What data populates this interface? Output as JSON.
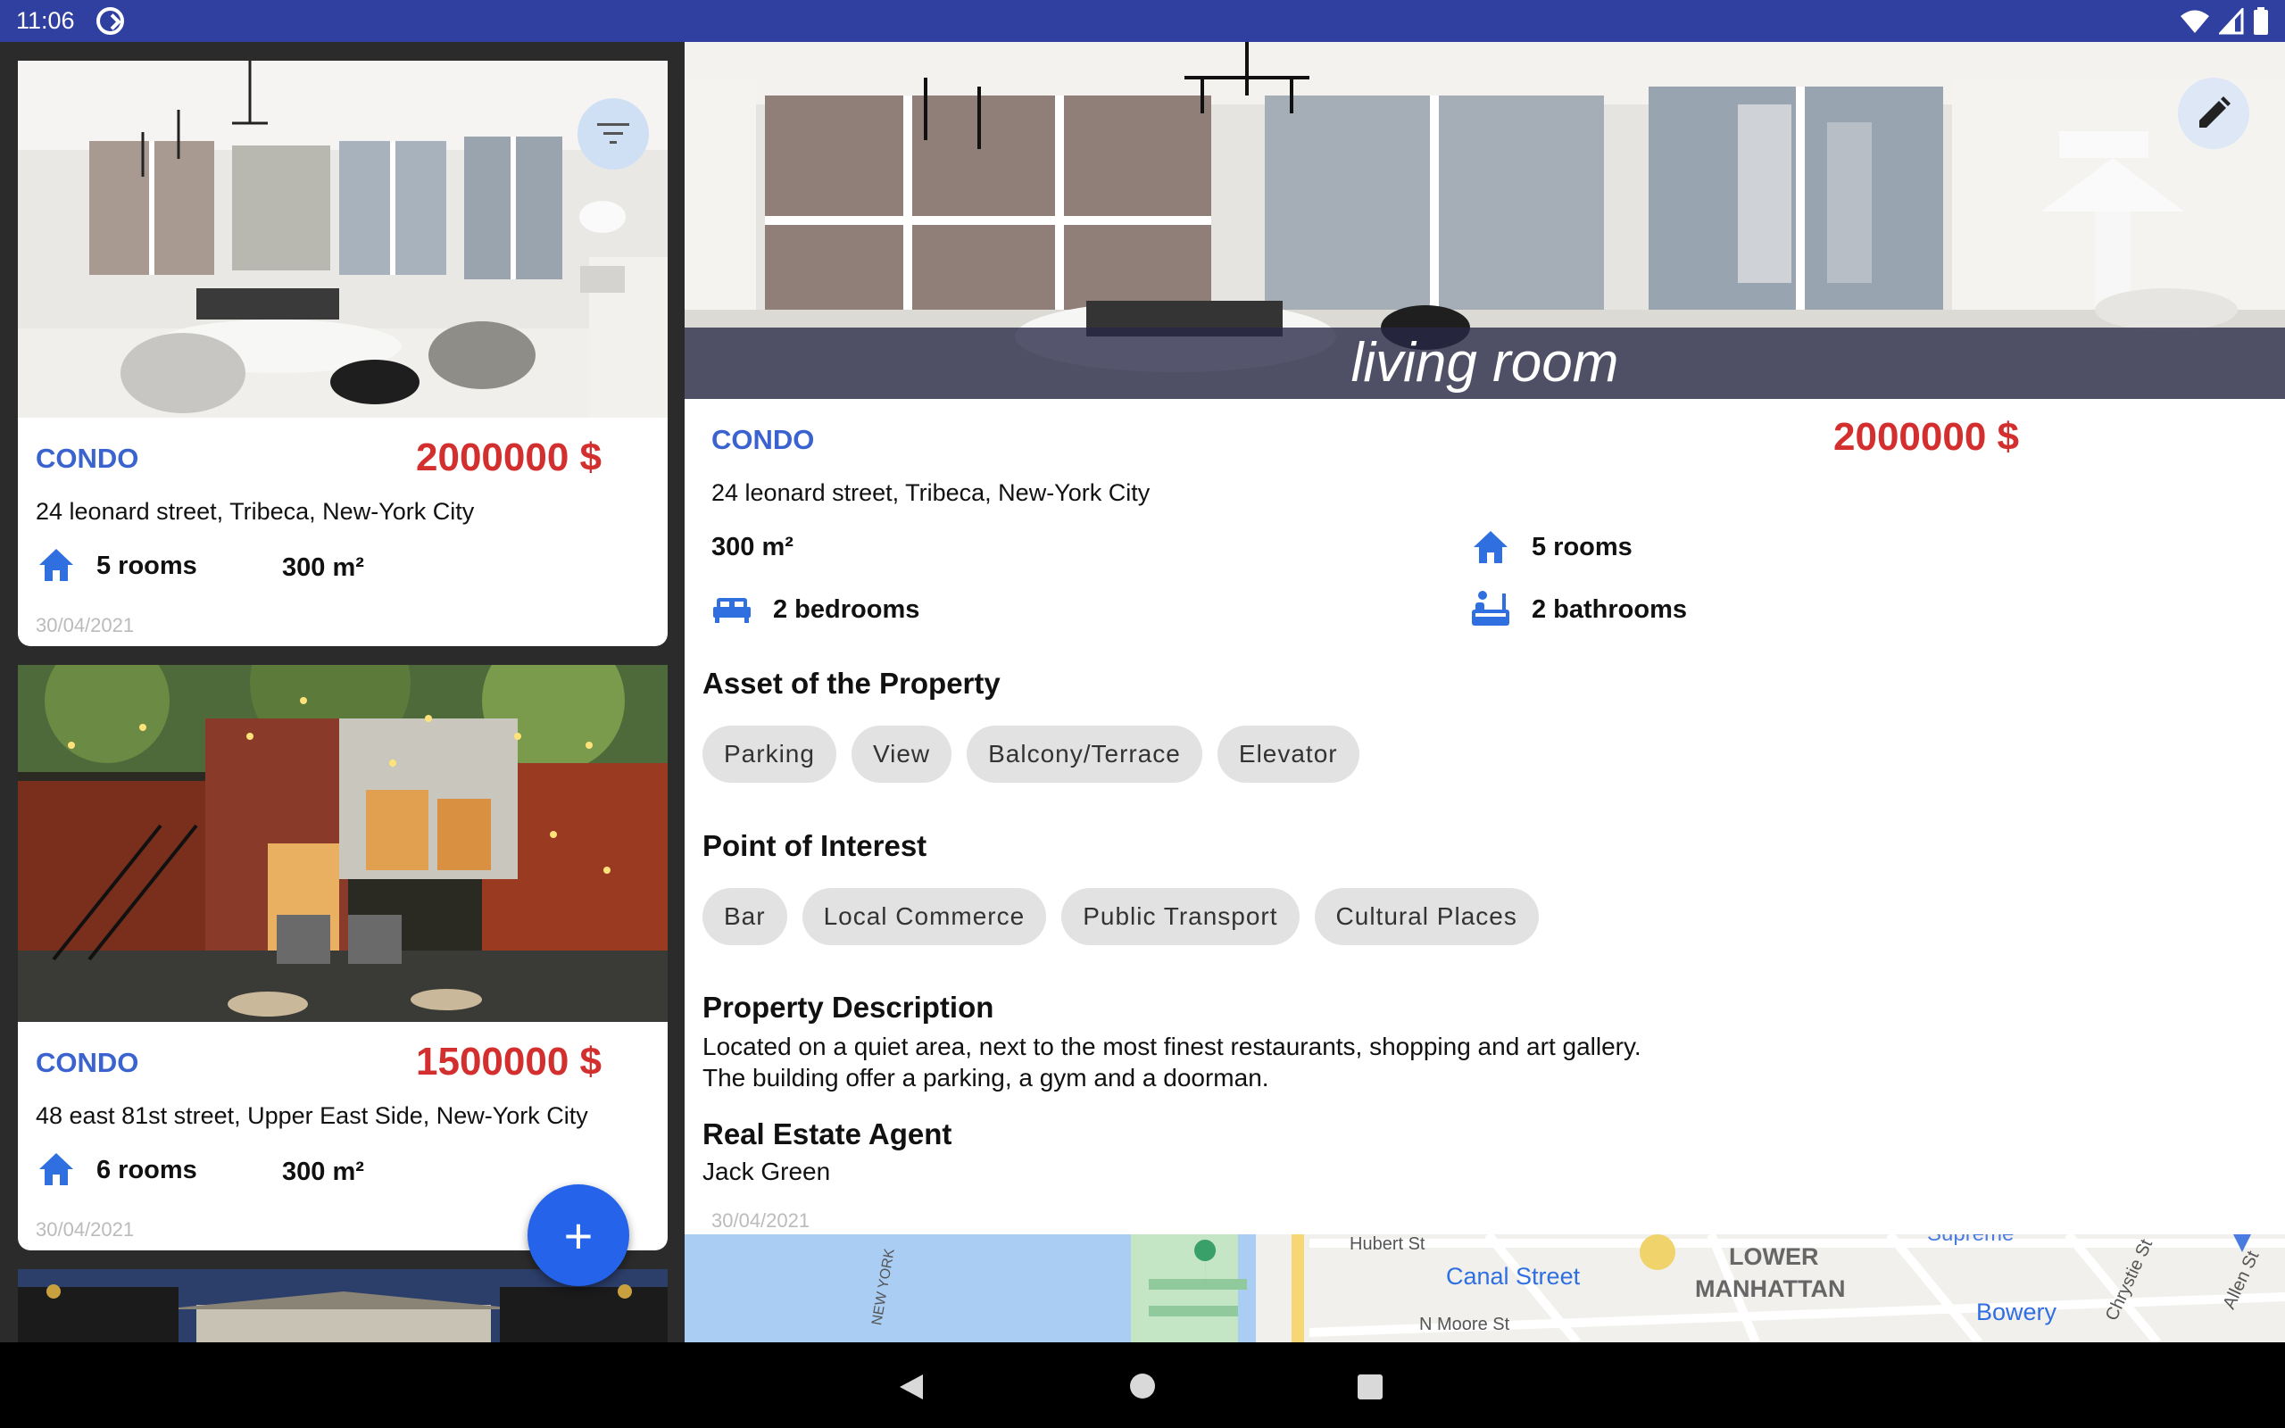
{
  "status_bar": {
    "time": "11:06",
    "app_indicator_icon": "circle-arrow-icon"
  },
  "list": {
    "cards": [
      {
        "type": "CONDO",
        "price": "2000000 $",
        "address": "24 leonard street, Tribeca, New-York City",
        "rooms": "5 rooms",
        "surface": "300 m²",
        "date": "30/04/2021",
        "photo": "living room"
      },
      {
        "type": "CONDO",
        "price": "1500000 $",
        "address": "48 east 81st street, Upper East Side, New-York City",
        "rooms": "6 rooms",
        "surface": "300 m²",
        "date": "30/04/2021",
        "photo": "courtyard"
      }
    ],
    "fab_label": "+"
  },
  "detail": {
    "photo_caption": "living room",
    "type": "CONDO",
    "price": "2000000 $",
    "address": "24 leonard street, Tribeca, New-York City",
    "surface": "300 m²",
    "rooms": "5 rooms",
    "bedrooms": "2 bedrooms",
    "bathrooms": "2 bathrooms",
    "assets_title": "Asset of the Property",
    "assets": [
      "Parking",
      "View",
      "Balcony/Terrace",
      "Elevator"
    ],
    "poi_title": "Point of Interest",
    "poi": [
      "Bar",
      "Local Commerce",
      "Public Transport",
      "Cultural Places"
    ],
    "description_title": "Property Description",
    "description_lines": [
      "Located on a quiet area, next to the most finest restaurants, shopping and art gallery.",
      "The building offer a parking, a gym and a doorman."
    ],
    "agent_title": "Real Estate Agent",
    "agent_name": "Jack Green",
    "date": "30/04/2021",
    "map": {
      "labels": [
        "Hubert St",
        "Canal Street",
        "LOWER",
        "MANHATTAN",
        "N Moore St",
        "Bowery",
        "NEW YORK",
        "Chrystie St",
        "Allen St",
        "Supreme"
      ]
    }
  },
  "colors": {
    "accent": "#3a63cf",
    "price": "#d32f2f",
    "status_bar": "#3040a0",
    "fab": "#2563eb"
  }
}
